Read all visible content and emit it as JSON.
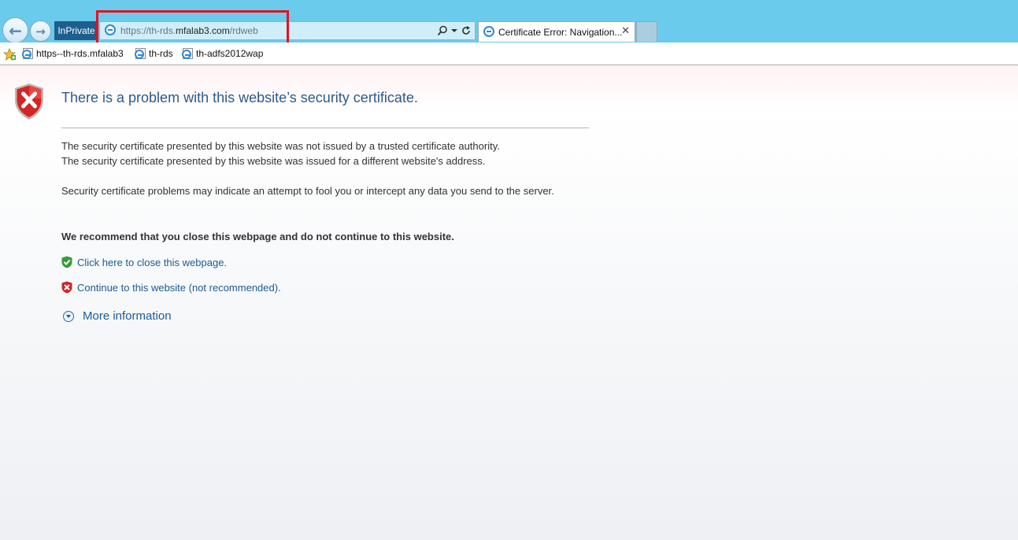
{
  "browser": {
    "inprivate_label": "InPrivate",
    "address": {
      "url_prefix": "https://th-rds.",
      "url_host": "mfalab3.com",
      "url_path": "/rdweb"
    },
    "tab": {
      "title": "Certificate Error: Navigation...",
      "close_glyph": "✕"
    },
    "highlight_color": "#e8101c",
    "accent_color": "#6bcbec"
  },
  "favorites": [
    {
      "label": "https--th-rds.mfalab3",
      "icon": "ie-page-icon"
    },
    {
      "label": "th-rds",
      "icon": "ie-page-icon"
    },
    {
      "label": "th-adfs2012wap",
      "icon": "ie-page-icon"
    }
  ],
  "page": {
    "title": "There is a problem with this website’s security certificate.",
    "paragraph1": "The security certificate presented by this website was not issued by a trusted certificate authority.",
    "paragraph2": "The security certificate presented by this website was issued for a different website's address.",
    "paragraph3": "Security certificate problems may indicate an attempt to fool you or intercept any data you send to the server.",
    "recommendation": "We recommend that you close this webpage and do not continue to this website.",
    "close_link": "Click here to close this webpage.",
    "continue_link": "Continue to this website (not recommended).",
    "more_info": "More information",
    "title_color": "#2c5a8c",
    "link_color": "#1a5b96"
  }
}
